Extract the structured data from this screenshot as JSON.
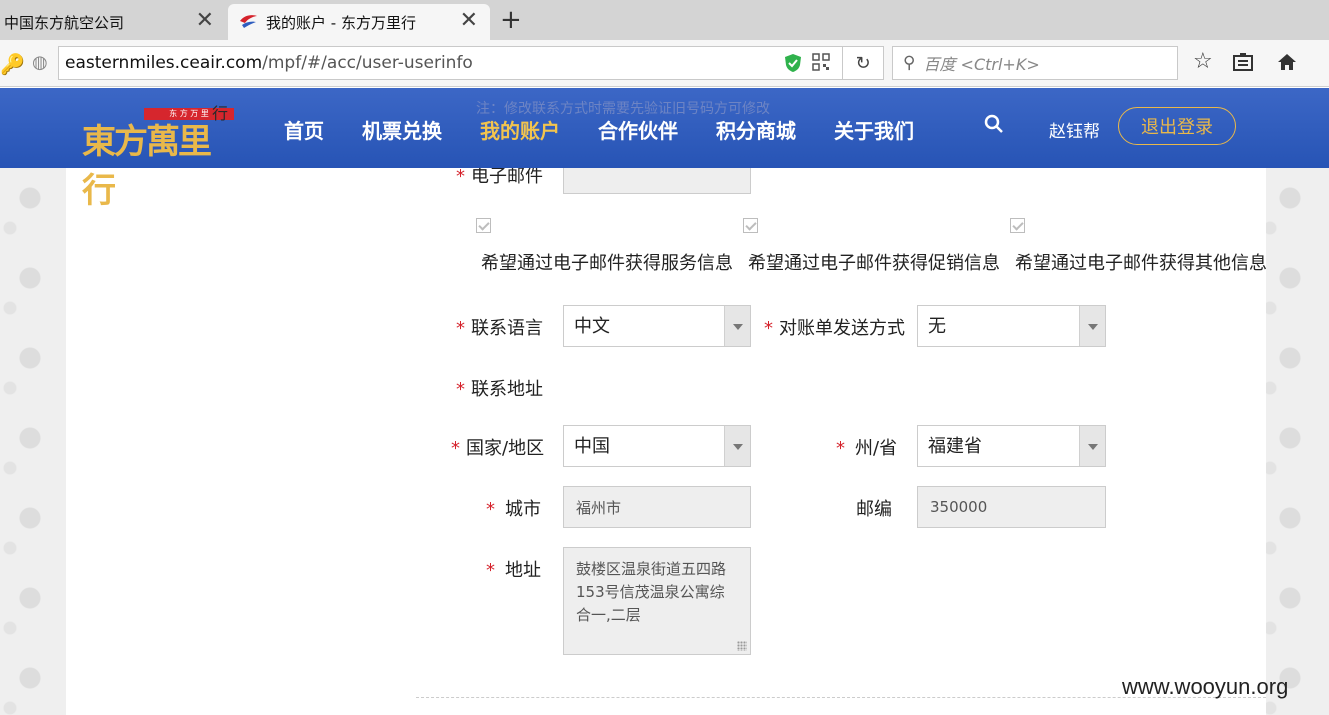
{
  "browser": {
    "tabs": [
      {
        "title": "中国东方航空公司",
        "active": false
      },
      {
        "title": "我的账户 - 东方万里行",
        "active": true
      }
    ],
    "url_host": "easternmiles.ceair.com",
    "url_path": "/mpf/#/acc/user-userinfo",
    "search_placeholder": "百度 <Ctrl+K>"
  },
  "header": {
    "logo_text": "東方萬里行",
    "logo_tag": "东 方 万 里",
    "note_char": "行",
    "note": "注：修改联系方式时需要先验证旧号码方可修改",
    "nav": [
      "首页",
      "机票兑换",
      "我的账户",
      "合作伙伴",
      "积分商城",
      "关于我们"
    ],
    "active_nav": "我的账户",
    "user_name": "赵钰帮",
    "logout_label": "退出登录"
  },
  "form": {
    "email_label": "电子邮件",
    "email_value": "",
    "checkboxes": [
      {
        "label": "希望通过电子邮件获得服务信息",
        "checked": true
      },
      {
        "label": "希望通过电子邮件获得促销信息",
        "checked": true
      },
      {
        "label": "希望通过电子邮件获得其他信息",
        "checked": true
      }
    ],
    "language_label": "联系语言",
    "language_value": "中文",
    "statement_label": "对账单发送方式",
    "statement_value": "无",
    "address_section_label": "联系地址",
    "country_label": "国家/地区",
    "country_value": "中国",
    "province_label": "州/省",
    "province_value": "福建省",
    "city_label": "城市",
    "city_value": "福州市",
    "zip_label": "邮编",
    "zip_value": "350000",
    "address_label": "地址",
    "address_value": "鼓楼区温泉街道五四路153号信茂温泉公寓综合一,二层",
    "required_mark": "*"
  },
  "watermark": "www.wooyun.org",
  "colors": {
    "header_blue": "#2f5dbf",
    "nav_active": "#f2c44e",
    "required_red": "#d5222b"
  }
}
